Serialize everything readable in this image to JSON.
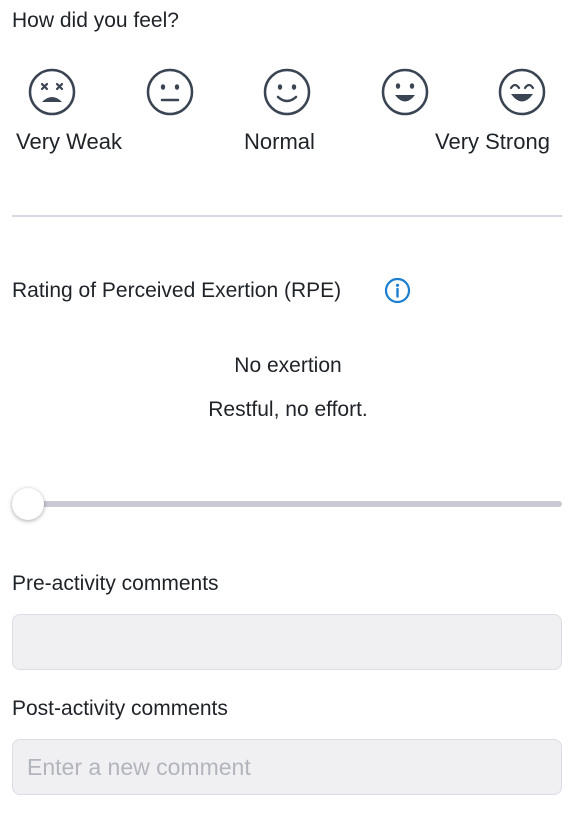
{
  "feel": {
    "title": "How did you feel?",
    "faces": [
      {
        "icon": "very-weak-face-icon"
      },
      {
        "icon": "weak-face-icon"
      },
      {
        "icon": "normal-face-icon"
      },
      {
        "icon": "strong-face-icon"
      },
      {
        "icon": "very-strong-face-icon"
      }
    ],
    "scale_labels": {
      "low": "Very Weak",
      "mid": "Normal",
      "high": "Very Strong"
    }
  },
  "rpe": {
    "title": "Rating of Perceived Exertion (RPE)",
    "info_icon": "info-circle-icon",
    "level_label": "No exertion",
    "level_description": "Restful, no effort.",
    "slider_value_fraction": 0
  },
  "comments": {
    "pre_label": "Pre-activity comments",
    "pre_value": "",
    "post_label": "Post-activity comments",
    "post_placeholder": "Enter a new comment"
  },
  "colors": {
    "text": "#1f2328",
    "icon_stroke": "#3a4452",
    "info_accent": "#1a7fd1",
    "divider": "#d7d8e2",
    "slider_track": "#c9cad4",
    "input_background": "#f0f0f2",
    "placeholder": "#b3b5bd"
  }
}
